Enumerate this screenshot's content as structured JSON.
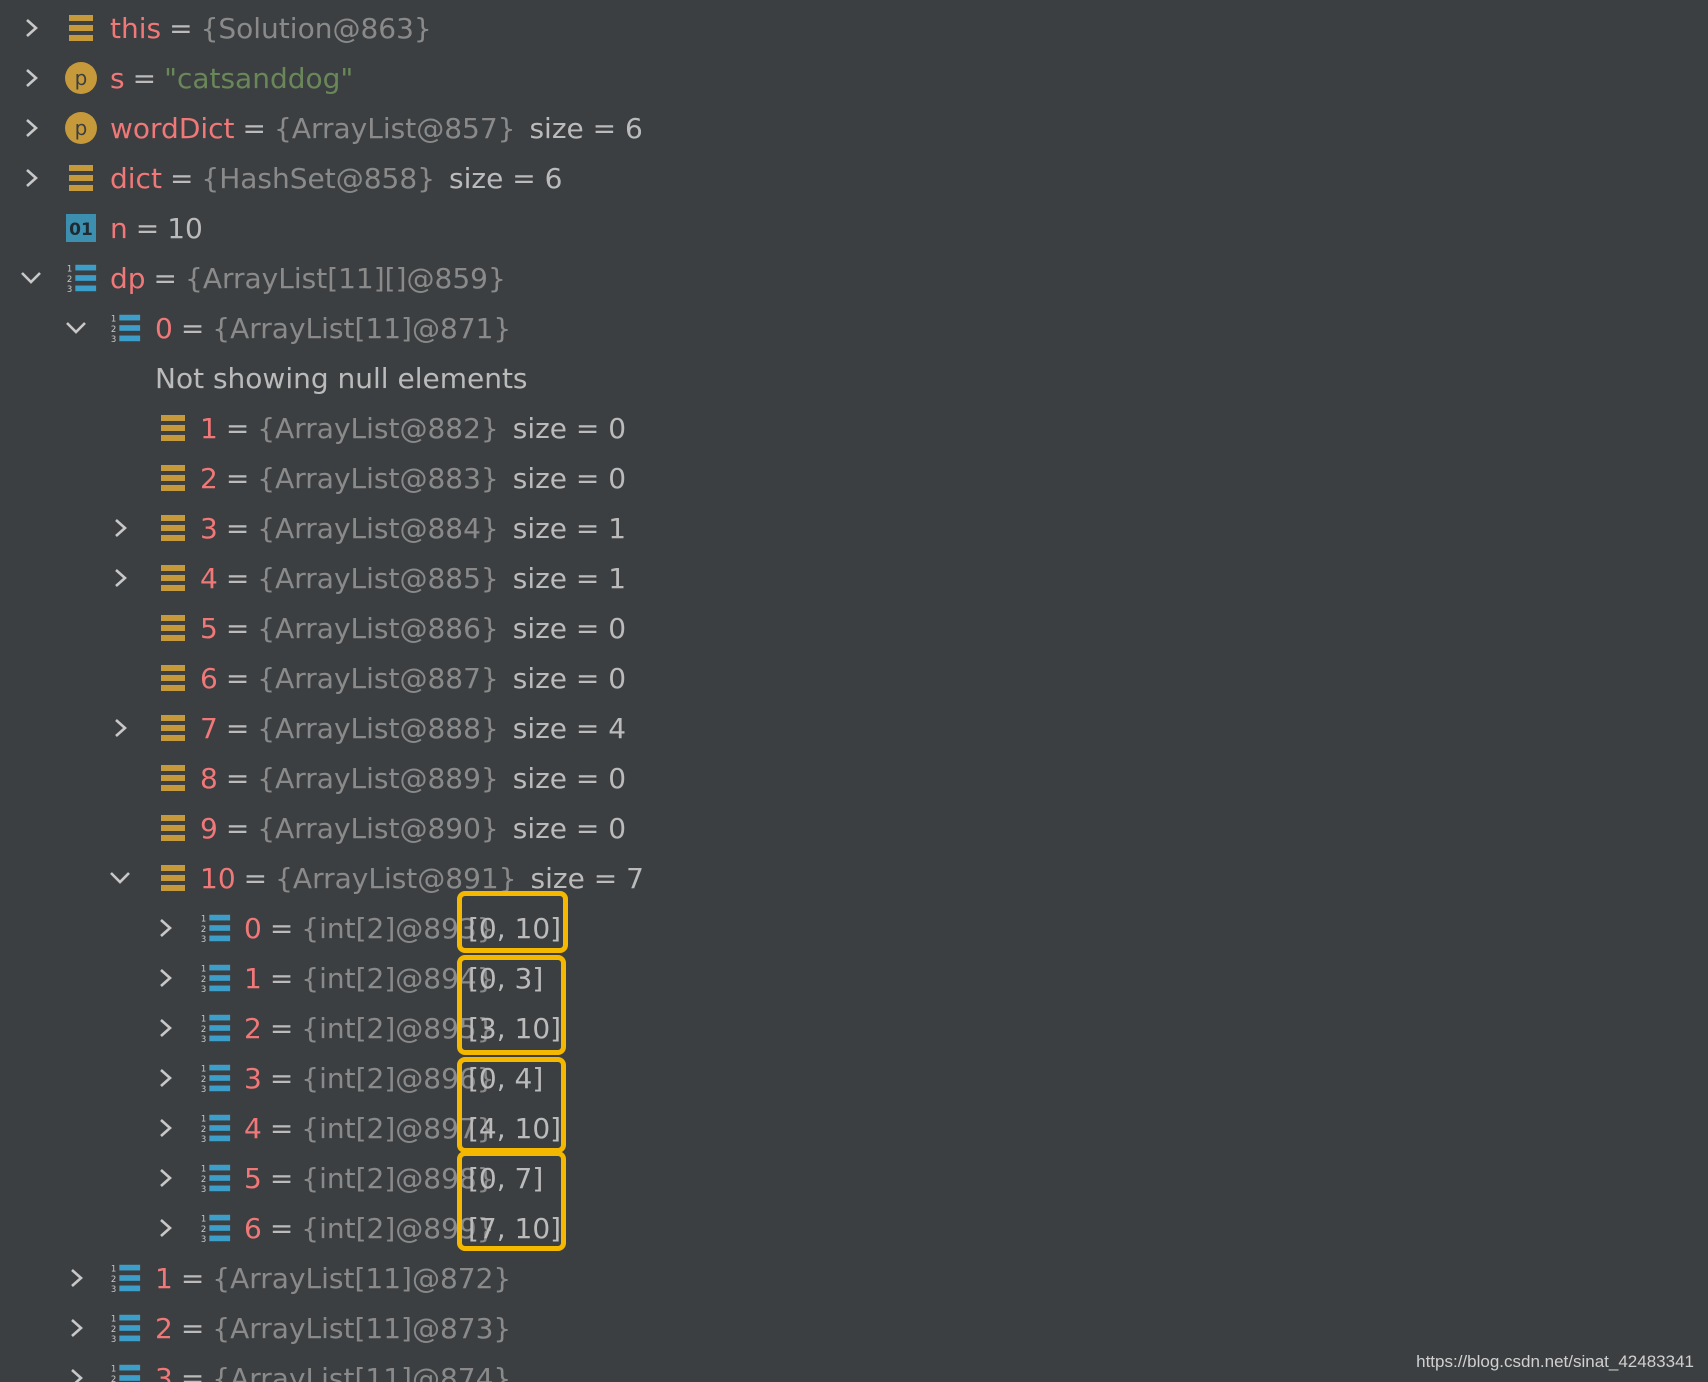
{
  "colors": {
    "background": "#3c3f41",
    "variable_name": "#f07878",
    "type_text": "#8a8a8a",
    "value_text": "#bbbbbb",
    "string_value": "#6a8759",
    "field_icon": "#c69a3a",
    "param_icon": "#c69a3a",
    "array_icon": "#3d9fc9",
    "highlight": "#f5b800"
  },
  "rows": [
    {
      "arrow": "collapsed",
      "icon": "field-icon",
      "name": "this",
      "type": "{Solution@863}",
      "value": "",
      "size": ""
    },
    {
      "arrow": "collapsed",
      "icon": "parameter-icon",
      "name": "s",
      "type": "",
      "value": "\"catsanddog\"",
      "size": ""
    },
    {
      "arrow": "collapsed",
      "icon": "parameter-icon",
      "name": "wordDict",
      "type": "{ArrayList@857}",
      "value": "",
      "size": "size = 6"
    },
    {
      "arrow": "collapsed",
      "icon": "field-icon",
      "name": "dict",
      "type": "{HashSet@858}",
      "value": "",
      "size": "size = 6"
    },
    {
      "arrow": "none",
      "icon": "primitive-icon",
      "name": "n",
      "type": "",
      "value": "10",
      "size": ""
    },
    {
      "arrow": "expanded",
      "icon": "array-icon",
      "name": "dp",
      "type": "{ArrayList[11][]@859}",
      "value": "",
      "size": ""
    },
    {
      "arrow": "expanded",
      "icon": "array-icon",
      "name": "0",
      "type": "{ArrayList[11]@871}",
      "value": "",
      "size": ""
    },
    {
      "arrow": "none",
      "icon": "none",
      "info": "Not showing null elements"
    },
    {
      "arrow": "none",
      "icon": "field-icon",
      "name": "1",
      "type": "{ArrayList@882}",
      "value": "",
      "size": "size = 0"
    },
    {
      "arrow": "none",
      "icon": "field-icon",
      "name": "2",
      "type": "{ArrayList@883}",
      "value": "",
      "size": "size = 0"
    },
    {
      "arrow": "collapsed",
      "icon": "field-icon",
      "name": "3",
      "type": "{ArrayList@884}",
      "value": "",
      "size": "size = 1"
    },
    {
      "arrow": "collapsed",
      "icon": "field-icon",
      "name": "4",
      "type": "{ArrayList@885}",
      "value": "",
      "size": "size = 1"
    },
    {
      "arrow": "none",
      "icon": "field-icon",
      "name": "5",
      "type": "{ArrayList@886}",
      "value": "",
      "size": "size = 0"
    },
    {
      "arrow": "none",
      "icon": "field-icon",
      "name": "6",
      "type": "{ArrayList@887}",
      "value": "",
      "size": "size = 0"
    },
    {
      "arrow": "collapsed",
      "icon": "field-icon",
      "name": "7",
      "type": "{ArrayList@888}",
      "value": "",
      "size": "size = 4"
    },
    {
      "arrow": "none",
      "icon": "field-icon",
      "name": "8",
      "type": "{ArrayList@889}",
      "value": "",
      "size": "size = 0"
    },
    {
      "arrow": "none",
      "icon": "field-icon",
      "name": "9",
      "type": "{ArrayList@890}",
      "value": "",
      "size": "size = 0"
    },
    {
      "arrow": "expanded",
      "icon": "field-icon",
      "name": "10",
      "type": "{ArrayList@891}",
      "value": "",
      "size": "size = 7"
    },
    {
      "arrow": "collapsed",
      "icon": "array-icon",
      "name": "0",
      "type": "{int[2]@893}",
      "value": "[0, 10]",
      "size": ""
    },
    {
      "arrow": "collapsed",
      "icon": "array-icon",
      "name": "1",
      "type": "{int[2]@894}",
      "value": "[0, 3]",
      "size": ""
    },
    {
      "arrow": "collapsed",
      "icon": "array-icon",
      "name": "2",
      "type": "{int[2]@895}",
      "value": "[3, 10]",
      "size": ""
    },
    {
      "arrow": "collapsed",
      "icon": "array-icon",
      "name": "3",
      "type": "{int[2]@896}",
      "value": "[0, 4]",
      "size": ""
    },
    {
      "arrow": "collapsed",
      "icon": "array-icon",
      "name": "4",
      "type": "{int[2]@897}",
      "value": "[4, 10]",
      "size": ""
    },
    {
      "arrow": "collapsed",
      "icon": "array-icon",
      "name": "5",
      "type": "{int[2]@898}",
      "value": "[0, 7]",
      "size": ""
    },
    {
      "arrow": "collapsed",
      "icon": "array-icon",
      "name": "6",
      "type": "{int[2]@899}",
      "value": "[7, 10]",
      "size": ""
    },
    {
      "arrow": "collapsed",
      "icon": "array-icon",
      "name": "1",
      "type": "{ArrayList[11]@872}",
      "value": "",
      "size": ""
    },
    {
      "arrow": "collapsed",
      "icon": "array-icon",
      "name": "2",
      "type": "{ArrayList[11]@873}",
      "value": "",
      "size": ""
    },
    {
      "arrow": "collapsed",
      "icon": "array-icon",
      "name": "3",
      "type": "{ArrayList[11]@874}",
      "value": "",
      "size": ""
    }
  ],
  "watermark": "https://blog.csdn.net/sinat_42483341"
}
